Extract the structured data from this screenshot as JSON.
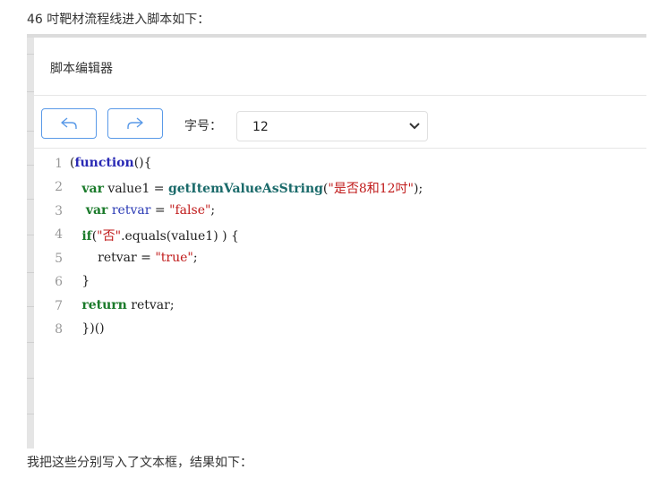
{
  "intro_text": "46 吋靶材流程线进入脚本如下：",
  "outro_text": "我把这些分别写入了文本框，结果如下：",
  "dialog": {
    "title": "脚本编辑器"
  },
  "toolbar": {
    "undo_icon": "undo-arrow-icon",
    "redo_icon": "redo-arrow-icon",
    "font_size_label": "字号：",
    "font_size_value": "12"
  },
  "editor": {
    "lines": [
      {
        "num": "1",
        "tokens": [
          {
            "t": "(",
            "c": "plain"
          },
          {
            "t": "function",
            "c": "kw-blue"
          },
          {
            "t": "(){",
            "c": "plain"
          }
        ]
      },
      {
        "num": "2",
        "tokens": [
          {
            "t": "   ",
            "c": "plain"
          },
          {
            "t": "var",
            "c": "kw-green"
          },
          {
            "t": " value1 = ",
            "c": "plain"
          },
          {
            "t": "getItemValueAsString",
            "c": "fn"
          },
          {
            "t": "(",
            "c": "plain"
          },
          {
            "t": "\"是否8和12吋\"",
            "c": "str"
          },
          {
            "t": ");",
            "c": "plain"
          }
        ]
      },
      {
        "num": "3",
        "tokens": [
          {
            "t": "    ",
            "c": "plain"
          },
          {
            "t": "var",
            "c": "kw-green"
          },
          {
            "t": " ",
            "c": "plain"
          },
          {
            "t": "retvar",
            "c": "var-blue"
          },
          {
            "t": " = ",
            "c": "plain"
          },
          {
            "t": "\"false\"",
            "c": "str"
          },
          {
            "t": ";",
            "c": "plain"
          }
        ]
      },
      {
        "num": "4",
        "tokens": [
          {
            "t": "   ",
            "c": "plain"
          },
          {
            "t": "if",
            "c": "kw-green"
          },
          {
            "t": "(",
            "c": "plain"
          },
          {
            "t": "\"否\"",
            "c": "str"
          },
          {
            "t": ".equals(value1) ) {",
            "c": "plain"
          }
        ]
      },
      {
        "num": "5",
        "tokens": [
          {
            "t": "       retvar = ",
            "c": "plain"
          },
          {
            "t": "\"true\"",
            "c": "str"
          },
          {
            "t": ";",
            "c": "plain"
          }
        ]
      },
      {
        "num": "6",
        "tokens": [
          {
            "t": "   }",
            "c": "plain"
          }
        ]
      },
      {
        "num": "7",
        "tokens": [
          {
            "t": "   ",
            "c": "plain"
          },
          {
            "t": "return",
            "c": "kw-green"
          },
          {
            "t": " retvar;",
            "c": "plain"
          }
        ]
      },
      {
        "num": "8",
        "tokens": [
          {
            "t": "   })()",
            "c": "plain"
          }
        ]
      }
    ]
  },
  "colors": {
    "accent": "#5a9ae8",
    "keyword_blue": "#2a2ab5",
    "keyword_green": "#1a7a2a",
    "string_red": "#c01a1a"
  }
}
